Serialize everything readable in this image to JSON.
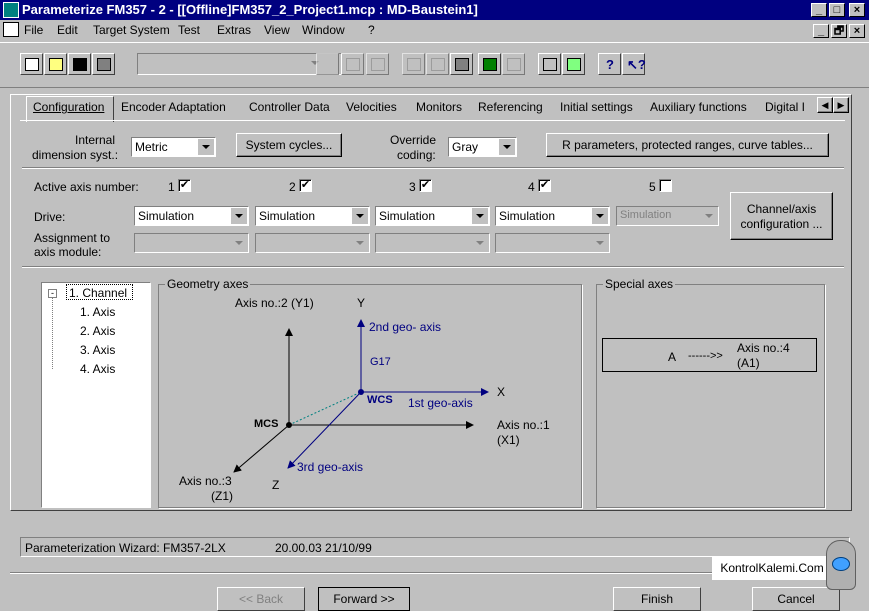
{
  "window": {
    "title": "Parameterize FM357 - 2 - [[Offline]FM357_2_Project1.mcp : MD-Baustein1]",
    "controls": [
      "_",
      "□",
      "×"
    ],
    "doc_controls": [
      "_",
      "🗗",
      "×"
    ]
  },
  "menu": [
    "File",
    "Edit",
    "Target System",
    "Test",
    "Extras",
    "View",
    "Window",
    "?"
  ],
  "tabs": [
    "Configuration",
    "Encoder Adaptation",
    "Controller Data",
    "Velocities",
    "Monitors",
    "Referencing",
    "Initial settings",
    "Auxiliary functions",
    "Digital I"
  ],
  "top_row": {
    "internal_label_1": "Internal",
    "internal_label_2": "dimension syst.:",
    "internal_value": "Metric",
    "system_cycles": "System cycles...",
    "override_label_1": "Override",
    "override_label_2": "coding:",
    "override_value": "Gray",
    "rparams": "R parameters, protected ranges, curve tables..."
  },
  "axes": {
    "active_label": "Active axis number:",
    "drive_label": "Drive:",
    "assign_label_1": "Assignment to",
    "assign_label_2": "axis module:",
    "items": [
      {
        "num": "1",
        "checked": true,
        "drive": "Simulation"
      },
      {
        "num": "2",
        "checked": true,
        "drive": "Simulation"
      },
      {
        "num": "3",
        "checked": true,
        "drive": "Simulation"
      },
      {
        "num": "4",
        "checked": true,
        "drive": "Simulation"
      },
      {
        "num": "5",
        "checked": false,
        "drive": "Simulation"
      }
    ],
    "channel_btn_1": "Channel/axis",
    "channel_btn_2": "configuration ..."
  },
  "tree": {
    "root": "1. Channel",
    "children": [
      "1. Axis",
      "2. Axis",
      "3. Axis",
      "4. Axis"
    ]
  },
  "geometry": {
    "title": "Geometry axes",
    "axis2": "Axis no.:2 (Y1)",
    "y": "Y",
    "geo2": "2nd geo- axis",
    "g17": "G17",
    "x": "X",
    "wcs": "WCS",
    "geo1": "1st geo-axis",
    "mcs": "MCS",
    "axis1_1": "Axis no.:1",
    "axis1_2": "(X1)",
    "geo3": "3rd geo-axis",
    "axis3_1": "Axis no.:3",
    "axis3_2": "(Z1)",
    "z": "Z"
  },
  "special": {
    "title": "Special axes",
    "a": "A",
    "arrow": "------>>",
    "axis4_1": "Axis no.:4",
    "axis4_2": "(A1)"
  },
  "status": {
    "wizard": "Parameterization Wizard: FM357-2LX",
    "version": "20.00.03 21/10/99"
  },
  "buttons": {
    "back": "<< Back",
    "forward": "Forward >>",
    "finish": "Finish",
    "cancel": "Cancel"
  },
  "watermark": "KontrolKalemi.Com"
}
